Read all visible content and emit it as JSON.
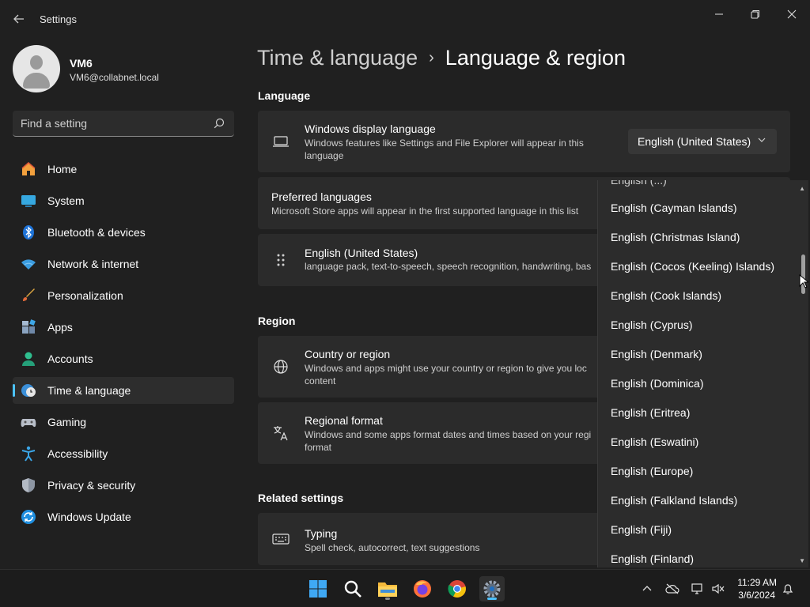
{
  "window": {
    "title": "Settings",
    "back_icon": "back-arrow-icon",
    "minimize_glyph": "—",
    "maximize_glyph": "❐",
    "close_glyph": "✕"
  },
  "user": {
    "name": "VM6",
    "email": "VM6@collabnet.local"
  },
  "search": {
    "placeholder": "Find a setting",
    "value": ""
  },
  "sidebar": {
    "items": [
      {
        "label": "Home",
        "icon": "home-icon"
      },
      {
        "label": "System",
        "icon": "system-icon"
      },
      {
        "label": "Bluetooth & devices",
        "icon": "bluetooth-icon"
      },
      {
        "label": "Network & internet",
        "icon": "network-icon"
      },
      {
        "label": "Personalization",
        "icon": "brush-icon"
      },
      {
        "label": "Apps",
        "icon": "apps-icon"
      },
      {
        "label": "Accounts",
        "icon": "accounts-icon"
      },
      {
        "label": "Time & language",
        "icon": "time-language-icon",
        "active": true
      },
      {
        "label": "Gaming",
        "icon": "gamepad-icon"
      },
      {
        "label": "Accessibility",
        "icon": "accessibility-icon"
      },
      {
        "label": "Privacy & security",
        "icon": "shield-icon"
      },
      {
        "label": "Windows Update",
        "icon": "update-icon"
      }
    ]
  },
  "breadcrumb": {
    "parent": "Time & language",
    "separator": "›",
    "current": "Language & region"
  },
  "sections": {
    "language": "Language",
    "region": "Region",
    "related": "Related settings"
  },
  "cards": {
    "display_language": {
      "title": "Windows display language",
      "description": "Windows features like Settings and File Explorer will appear in this language",
      "selected": "English (United States)"
    },
    "preferred_languages": {
      "title": "Preferred languages",
      "description": "Microsoft Store apps will appear in the first supported language in this list"
    },
    "english_us": {
      "title": "English (United States)",
      "description": "language pack, text-to-speech, speech recognition, handwriting, bas"
    },
    "country_region": {
      "title": "Country or region",
      "description": "Windows and apps might use your country or region to give you loc content"
    },
    "regional_format": {
      "title": "Regional format",
      "description": "Windows and some apps format dates and times based on your regi format"
    },
    "typing": {
      "title": "Typing",
      "description": "Spell check, autocorrect, text suggestions"
    }
  },
  "dropdown": {
    "options": [
      "English (Cayman Islands)",
      "English (Christmas Island)",
      "English (Cocos (Keeling) Islands)",
      "English (Cook Islands)",
      "English (Cyprus)",
      "English (Denmark)",
      "English (Dominica)",
      "English (Eritrea)",
      "English (Eswatini)",
      "English (Europe)",
      "English (Falkland Islands)",
      "English (Fiji)",
      "English (Finland)"
    ]
  },
  "taskbar": {
    "apps": [
      "start-icon",
      "search-icon",
      "file-explorer-icon",
      "firefox-icon",
      "chrome-icon",
      "settings-icon"
    ],
    "time": "11:29 AM",
    "date": "3/6/2024"
  },
  "colors": {
    "accent": "#4cc2ff",
    "background": "#202020",
    "card": "#2b2b2b"
  }
}
